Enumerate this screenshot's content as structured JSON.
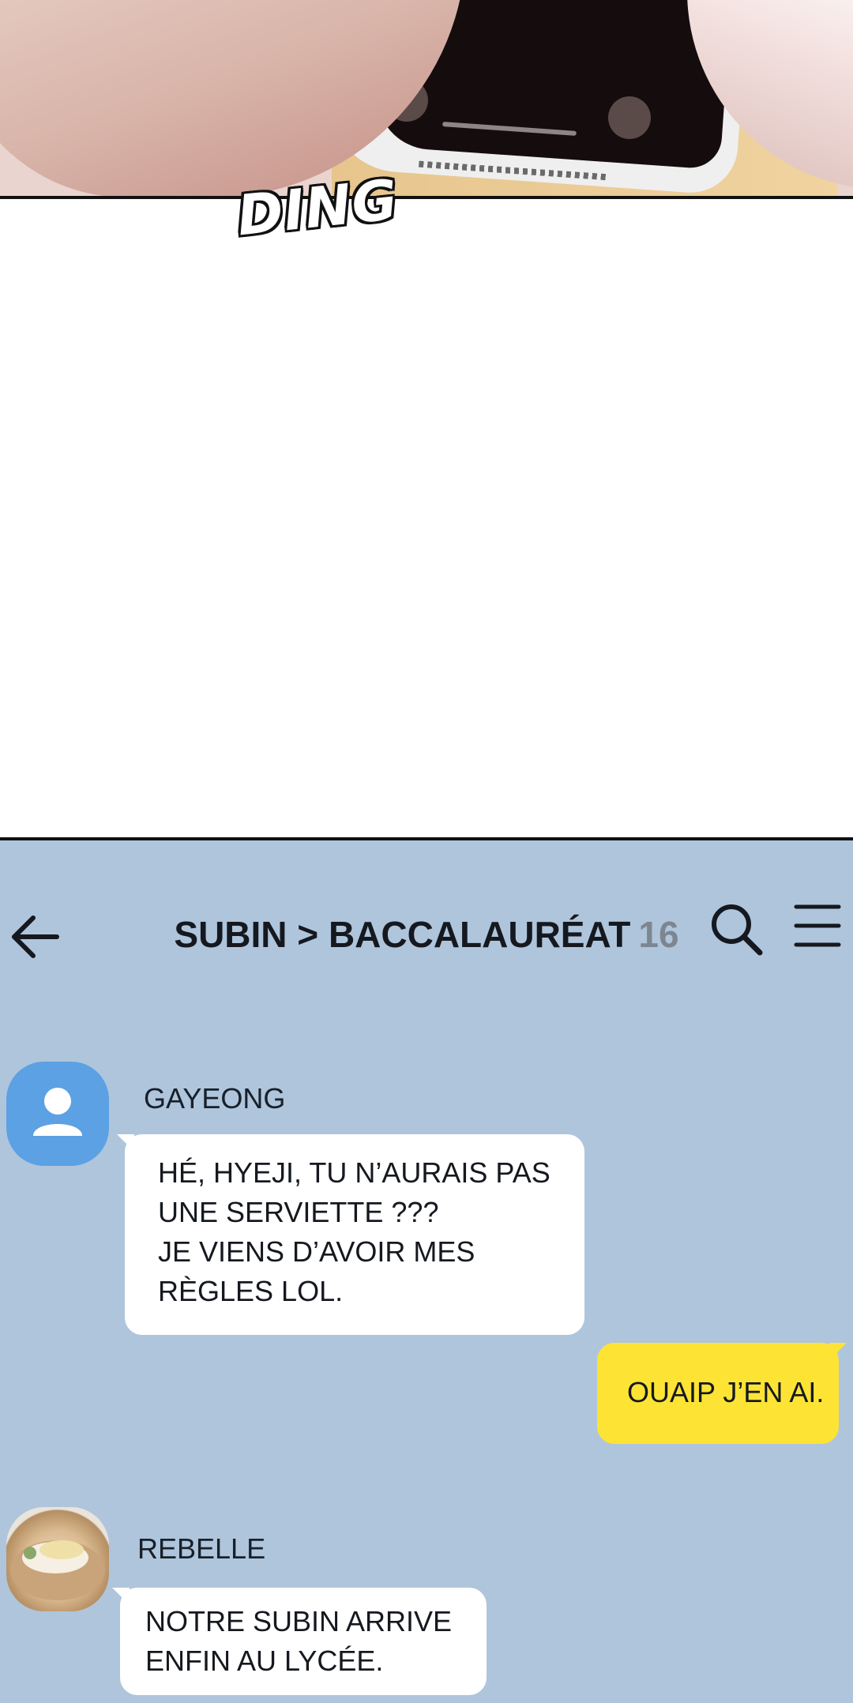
{
  "sound_effect": "DING",
  "chat": {
    "title": "SUBIN > BACCALAURÉAT",
    "member_count": "16",
    "icons": {
      "back": "arrow-left-icon",
      "search": "search-icon",
      "menu": "hamburger-menu-icon"
    },
    "colors": {
      "background": "#afc5dc",
      "my_bubble": "#fde434",
      "other_bubble": "#ffffff",
      "default_avatar": "#5ca1e3"
    },
    "messages": [
      {
        "sender": "GAYEONG",
        "avatar": "default-user-avatar",
        "lines": [
          "HÉ, HYEJI, TU N’AURAIS PAS",
          "UNE SERVIETTE ???",
          "JE VIENS D’AVOIR MES",
          "RÈGLES LOL."
        ]
      },
      {
        "sender": "",
        "from_me": true,
        "lines": [
          "OUAIP J’EN AI."
        ]
      },
      {
        "sender": "REBELLE",
        "avatar": "food-photo-avatar",
        "lines": [
          "NOTRE SUBIN ARRIVE",
          "ENFIN AU LYCÉE."
        ]
      }
    ]
  }
}
